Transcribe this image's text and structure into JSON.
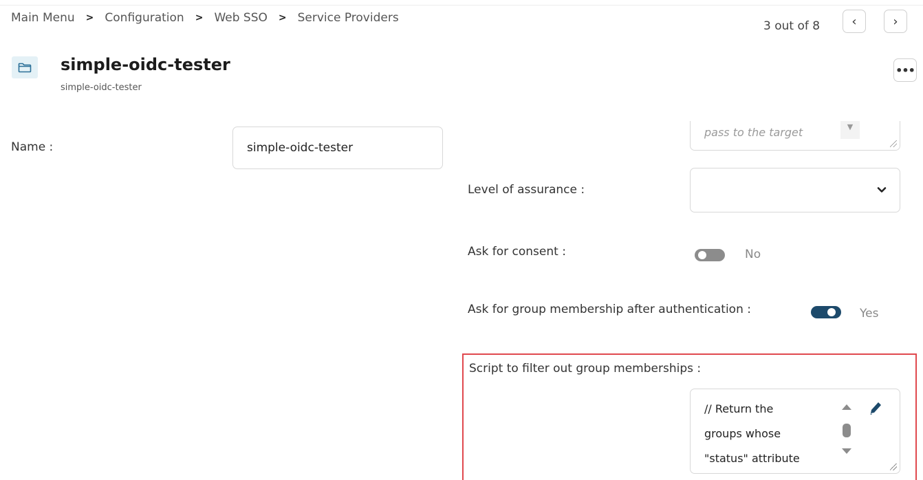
{
  "breadcrumb": {
    "items": [
      "Main Menu",
      "Configuration",
      "Web SSO",
      "Service Providers"
    ],
    "separator": ">"
  },
  "pager": {
    "count_text": "3 out of 8",
    "prev_glyph": "‹",
    "next_glyph": "›"
  },
  "header": {
    "title": "simple-oidc-tester",
    "subtitle": "simple-oidc-tester",
    "more_glyph": "•••"
  },
  "form": {
    "name_label": "Name :",
    "name_value": "simple-oidc-tester",
    "partial_field_text": "pass to the target",
    "level_of_assurance_label": "Level of assurance :",
    "level_of_assurance_value": "",
    "ask_consent_label": "Ask for consent :",
    "ask_consent_state": "No",
    "ask_group_label": "Ask for group membership after authentication :",
    "ask_group_state": "Yes",
    "script_label": "Script to filter out group memberships :",
    "script_lines": [
      "// Return the",
      "groups whose",
      "\"status\" attribute"
    ]
  },
  "colors": {
    "accent": "#1d4a6b",
    "highlight_border": "#e0484d",
    "folder_bg": "#e4f1f6"
  },
  "icons": [
    "folder-icon",
    "chevron-left-icon",
    "chevron-right-icon",
    "more-icon",
    "chevron-down-icon",
    "pencil-icon"
  ]
}
